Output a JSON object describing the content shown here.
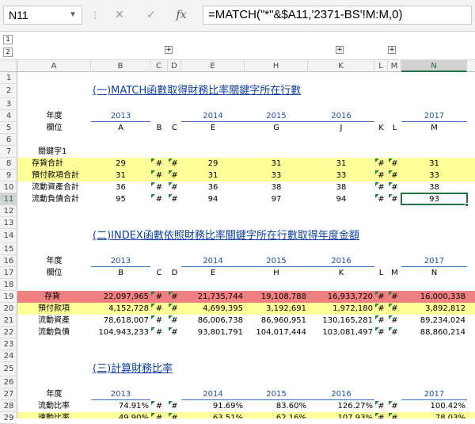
{
  "name_box": "N11",
  "formula_bar": {
    "cancel_icon": "✕",
    "enter_icon": "✓",
    "fx_label": "fx",
    "formula": "=MATCH(\"*\"&$A11,'2371-BS'!M:M,0)"
  },
  "outline": {
    "level1": "1",
    "level2": "2",
    "expand": "+"
  },
  "columns": [
    "A",
    "B",
    "C",
    "D",
    "E",
    "H",
    "K",
    "L",
    "M",
    "N"
  ],
  "rows": [
    "1",
    "2",
    "3",
    "4",
    "5",
    "6",
    "7",
    "8",
    "9",
    "10",
    "11",
    "12",
    "13",
    "14",
    "15",
    "16",
    "17",
    "18",
    "19",
    "20",
    "21",
    "22",
    "23",
    "24",
    "25",
    "26",
    "27",
    "28",
    "29"
  ],
  "hash": "#",
  "section1": {
    "title": "(一)MATCH函數取得財務比率關鍵字所在行數",
    "year_label": "年度",
    "field_label": "欄位",
    "years": [
      "2013",
      "2014",
      "2015",
      "2016",
      "2017"
    ],
    "fields": [
      "A",
      "B",
      "C",
      "E",
      "G",
      "J",
      "K",
      "L",
      "M"
    ],
    "keyword_label": "關鍵字1",
    "rows": [
      {
        "label": "存貨合計",
        "values": [
          "29",
          "29",
          "31",
          "31",
          "31"
        ]
      },
      {
        "label": "預付款項合計",
        "values": [
          "31",
          "31",
          "33",
          "33",
          "33"
        ]
      },
      {
        "label": "流動資產合計",
        "values": [
          "36",
          "36",
          "38",
          "38",
          "38"
        ]
      },
      {
        "label": "流動負債合計",
        "values": [
          "95",
          "94",
          "97",
          "94",
          "93"
        ]
      }
    ]
  },
  "section2": {
    "title": "(二)INDEX函數依照財務比率關鍵字所在行數取得年度金額",
    "year_label": "年度",
    "field_label": "欄位",
    "years": [
      "2013",
      "2014",
      "2015",
      "2016",
      "2017"
    ],
    "fields": [
      "B",
      "C",
      "D",
      "E",
      "H",
      "K",
      "L",
      "M",
      "N"
    ],
    "rows": [
      {
        "label": "存貨",
        "values": [
          "22,097,965",
          "21,735,744",
          "19,108,788",
          "16,933,720",
          "16,000,338"
        ]
      },
      {
        "label": "預付款項",
        "values": [
          "4,152,728",
          "4,699,395",
          "3,192,691",
          "1,972,180",
          "3,892,812"
        ]
      },
      {
        "label": "流動資產",
        "values": [
          "78,618,007",
          "86,006,738",
          "86,960,951",
          "130,165,281",
          "89,234,024"
        ]
      },
      {
        "label": "流動負債",
        "values": [
          "104,943,233",
          "93,801,791",
          "104,017,444",
          "103,081,497",
          "88,860,214"
        ]
      }
    ]
  },
  "section3": {
    "title": "(三)計算財務比率",
    "year_label": "年度",
    "years": [
      "2013",
      "2014",
      "2015",
      "2016",
      "2017"
    ],
    "rows": [
      {
        "label": "流動比率",
        "values": [
          "74.91%",
          "91.69%",
          "83.60%",
          "126.27%",
          "100.42%"
        ]
      },
      {
        "label": "速動比率",
        "values": [
          "49.90%",
          "63.51%",
          "62.16%",
          "107.93%",
          "78.03%"
        ]
      }
    ]
  },
  "colors": {
    "yellow": "#ffff99",
    "red": "#f08080",
    "selection": "#217346",
    "year_blue": "#1f4e9c"
  }
}
